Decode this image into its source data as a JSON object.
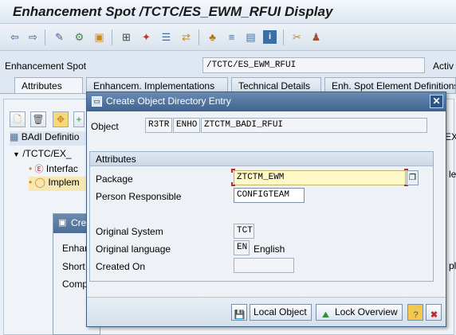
{
  "window": {
    "title": "Enhancement Spot /TCTC/ES_EWM_RFUI Display"
  },
  "toolbar": {
    "icons": [
      "back-arrow-icon",
      "forward-arrow-icon",
      "display-change-icon",
      "activate-icon",
      "other-object-icon",
      "hierarchy-icon",
      "magic-wand-icon",
      "list-icon",
      "where-used-icon",
      "tree-structure-icon",
      "align-icon",
      "layout-icon",
      "info-icon",
      "scissors-icon",
      "users-icon"
    ]
  },
  "spot_field": {
    "label": "Enhancement Spot",
    "value": "/TCTC/ES_EWM_RFUI",
    "status_prefix": "Activ"
  },
  "tabs": [
    {
      "label": "Attributes"
    },
    {
      "label": "Enhancem. Implementations"
    },
    {
      "label": "Technical Details"
    },
    {
      "label": "Enh. Spot Element Definitions"
    }
  ],
  "tree": {
    "header": "BAdI Definitio",
    "root": "/TCTC/EX_",
    "items": [
      "Interfac",
      "Implem"
    ]
  },
  "background_popup": {
    "title_fragment": "Cre",
    "labels": [
      "Enhan",
      "Short",
      "Comp"
    ]
  },
  "right_stubs": [
    "EX",
    "le",
    "pl"
  ],
  "dialog": {
    "title": "Create Object Directory Entry",
    "object": {
      "label": "Object",
      "pgmid": "R3TR",
      "type": "ENHO",
      "name": "ZTCTM_BADI_RFUI"
    },
    "attributes_group": "Attributes",
    "package": {
      "label": "Package",
      "value": "ZTCTM_EWM"
    },
    "person": {
      "label": "Person Responsible",
      "value": "CONFIGTEAM"
    },
    "original_system": {
      "label": "Original System",
      "value": "TCT"
    },
    "original_language": {
      "label": "Original language",
      "code": "EN",
      "name": "English"
    },
    "created_on": {
      "label": "Created On",
      "value": ""
    },
    "buttons": {
      "save": "",
      "local_object": "Local Object",
      "lock_overview": "Lock Overview",
      "help": "",
      "cancel": ""
    }
  },
  "colors": {
    "title_bar": "#4a6d98",
    "required_field": "#fff9c8",
    "cancel_red": "#c2262e"
  }
}
